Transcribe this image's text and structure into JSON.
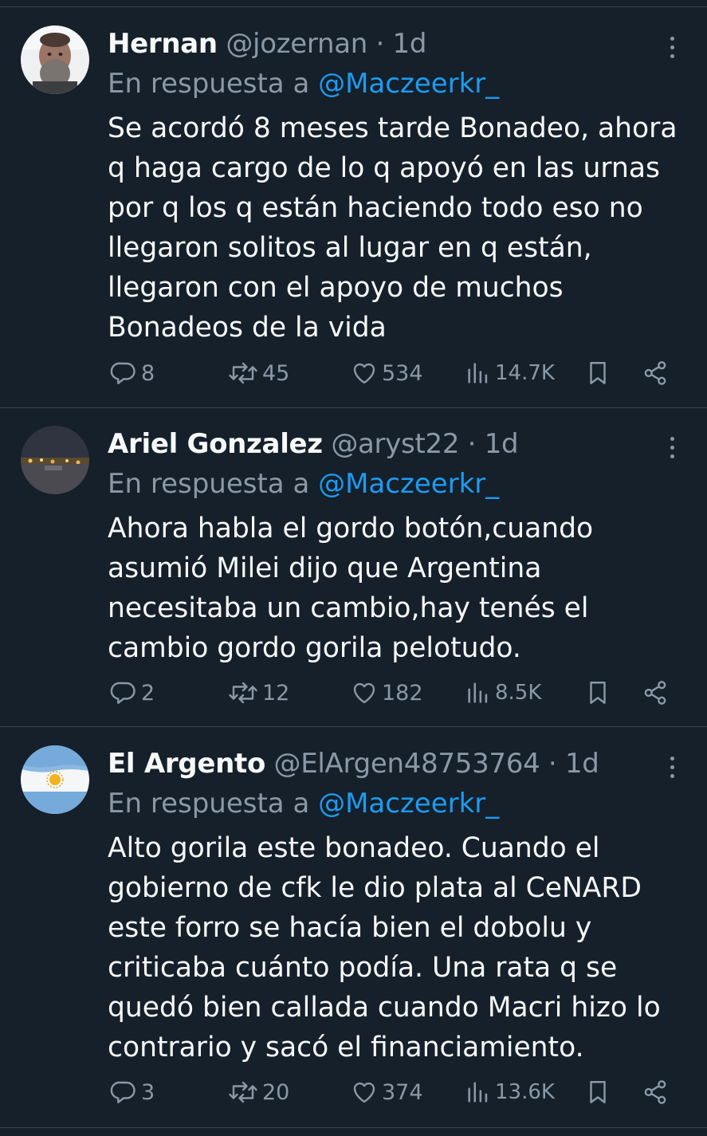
{
  "mention_prefix": "En respuesta a",
  "colors": {
    "background": "#15202b",
    "text": "#f7f9f9",
    "secondary": "#8b98a5",
    "accent": "#1d9bf0",
    "separator": "#38444d"
  },
  "tweets": [
    {
      "name": "Hernan",
      "handle": "@jozernan",
      "dot": "·",
      "time": "1d",
      "reply_to": "@Maczeerkr_",
      "text": "Se acordó 8 meses tarde Bonadeo, ahora q haga cargo de lo q apoyó en las urnas por q los q están haciendo todo eso no llegaron solitos al lugar en q están, llegaron con el apoyo de muchos Bonadeos de la vida",
      "replies": "8",
      "reposts": "45",
      "likes": "534",
      "views": "14.7K",
      "avatar": "bearded-man-photo"
    },
    {
      "name": "Ariel Gonzalez",
      "handle": "@aryst22",
      "dot": "·",
      "time": "1d",
      "reply_to": "@Maczeerkr_",
      "text": "Ahora habla el gordo botón,cuando asumió Milei dijo que Argentina necesitaba un cambio,hay tenés el cambio gordo gorila pelotudo.",
      "replies": "2",
      "reposts": "12",
      "likes": "182",
      "views": "8.5K",
      "avatar": "night-city-photo"
    },
    {
      "name": "El Argento",
      "handle": "@ElArgen48753764",
      "dot": "·",
      "time": "1d",
      "reply_to": "@Maczeerkr_",
      "text": "Alto gorila este bonadeo. Cuando el gobierno de cfk le dio plata al CeNARD este forro se hacía bien el dobolu y criticaba cuánto podía. Una rata q se quedó bien callada cuando Macri hizo lo contrario y sacó el financiamiento.",
      "replies": "3",
      "reposts": "20",
      "likes": "374",
      "views": "13.6K",
      "avatar": "argentina-flag"
    }
  ]
}
